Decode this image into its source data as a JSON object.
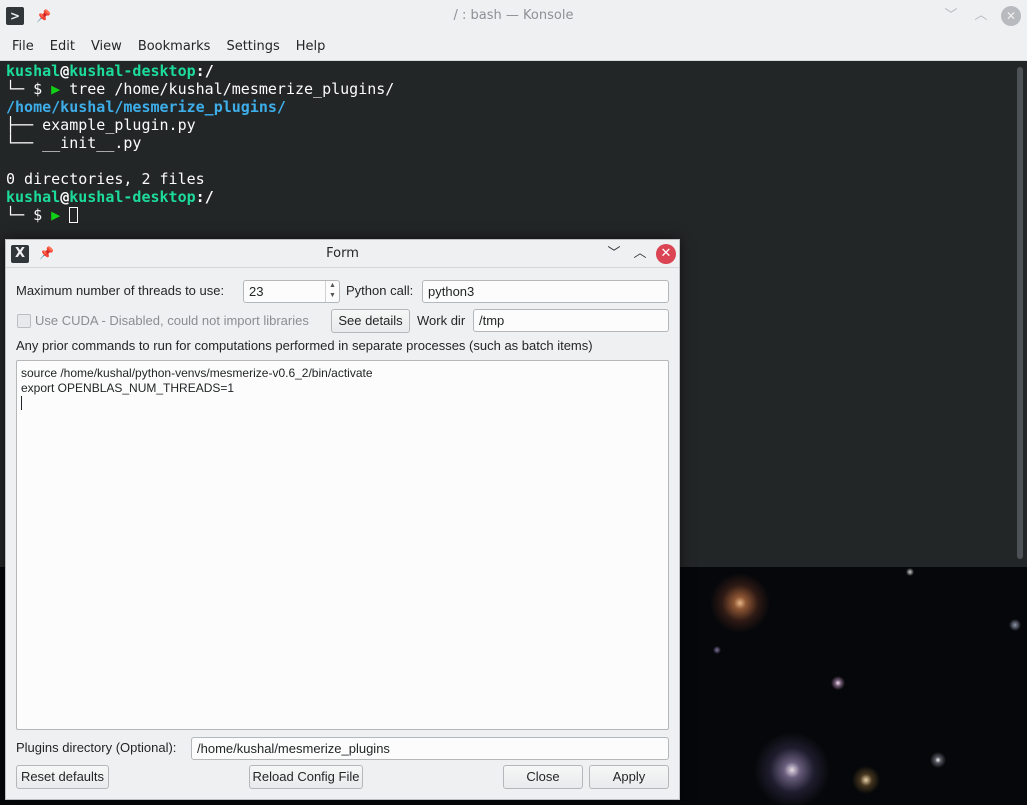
{
  "konsole": {
    "title": "/ : bash — Konsole",
    "menu": [
      "File",
      "Edit",
      "View",
      "Bookmarks",
      "Settings",
      "Help"
    ],
    "lines": [
      {
        "user": "kushal",
        "at": "@",
        "host": "kushal-desktop",
        "colon": ":",
        "path": "/"
      },
      {
        "prefix": "└─ $ ",
        "arrow": "▶",
        "cmd": " tree /home/kushal/mesmerize_plugins/"
      },
      {
        "dir": "/home/kushal/mesmerize_plugins/"
      },
      {
        "text": "├── example_plugin.py"
      },
      {
        "text": "└── __init__.py"
      },
      {
        "text": ""
      },
      {
        "text": "0 directories, 2 files"
      },
      {
        "user": "kushal",
        "at": "@",
        "host": "kushal-desktop",
        "colon": ":",
        "path": "/"
      },
      {
        "prefix": "└─ $ ",
        "arrow": "▶",
        "cmd": " "
      }
    ]
  },
  "form": {
    "title": "Form",
    "threads_label": "Maximum number of threads to use:",
    "threads_value": "23",
    "python_call_label": "Python call:",
    "python_call_value": "python3",
    "cuda_label": "Use CUDA - Disabled, could not import libraries",
    "cuda_checked": false,
    "see_details": "See details",
    "workdir_label": "Work dir",
    "workdir_value": "/tmp",
    "prior_commands_label": "Any prior commands to run for computations performed in separate processes (such as batch items)",
    "prior_commands": [
      "source /home/kushal/python-venvs/mesmerize-v0.6_2/bin/activate",
      "export OPENBLAS_NUM_THREADS=1"
    ],
    "plugins_label": "Plugins directory (Optional):",
    "plugins_value": "/home/kushal/mesmerize_plugins",
    "buttons": {
      "reset": "Reset defaults",
      "reload": "Reload Config File",
      "close": "Close",
      "apply": "Apply"
    }
  }
}
